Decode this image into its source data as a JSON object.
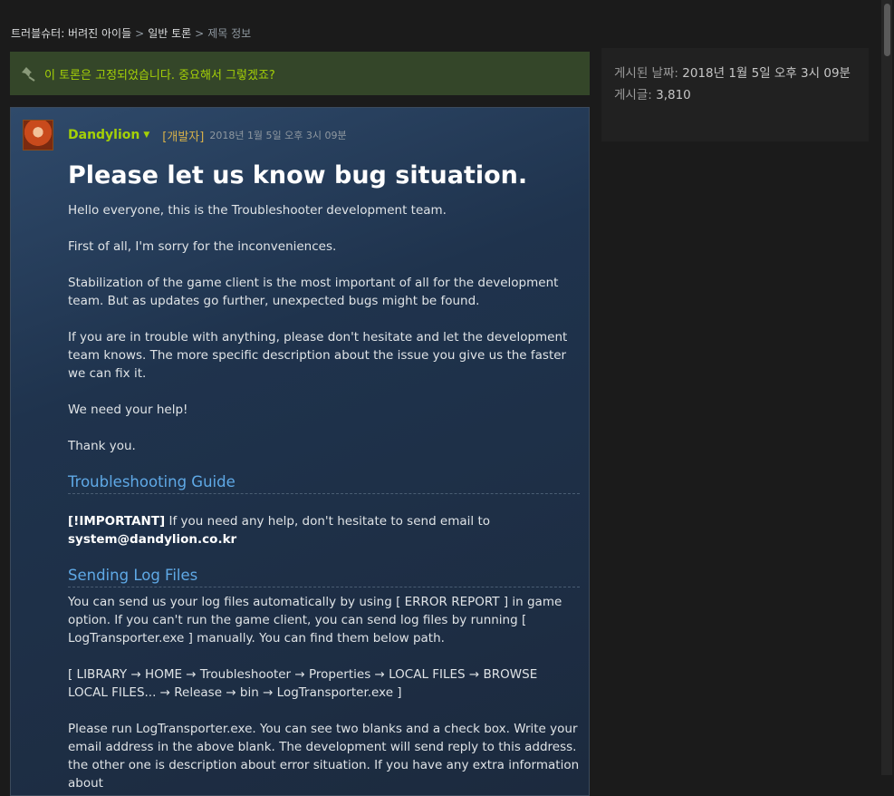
{
  "breadcrumb": {
    "items": [
      "트러블슈터: 버려진 아이들",
      "일반 토론",
      "제목 정보"
    ],
    "separator": ">"
  },
  "pinned_notice": {
    "text": "이 토론은 고정되었습니다. 중요해서 그렇겠죠?",
    "icon": "pin-icon"
  },
  "post": {
    "author": "Dandylion",
    "role": "[개발자]",
    "date": "2018년 1월 5일 오후 3시 09분",
    "title": "Please let us know bug situation.",
    "paragraphs": {
      "p1": "Hello everyone, this is the Troubleshooter development team.",
      "p2": "First of all, I'm sorry for the inconveniences.",
      "p3": "Stabilization of the game client is the most important of all for the development team. But as updates go further, unexpected bugs might be found.",
      "p4": "If you are in trouble with anything, please don't hesitate and let the development team knows. The more specific description about the issue you give us the faster we can fix it.",
      "p5": "We need your help!",
      "p6": "Thank you."
    },
    "section1": {
      "heading": "Troubleshooting Guide",
      "important_label": "[!IMPORTANT]",
      "important_text": " If you need any help, don't hesitate to send email to ",
      "email": "system@dandylion.co.kr"
    },
    "section2": {
      "heading": "Sending Log Files",
      "p1": "You can send us your log files automatically by using [ ERROR REPORT ] in game option. If you can't run the game client, you can send log files by running [ LogTransporter.exe ] manually. You can find them below path.",
      "p2": "[ LIBRARY → HOME → Troubleshooter → Properties → LOCAL FILES → BROWSE LOCAL FILES... → Release → bin → LogTransporter.exe ]",
      "p3": "Please run LogTransporter.exe. You can see two blanks and a check box. Write your email address in the above blank. The development will send reply to this address. the other one is description about error situation. If you have any extra information about"
    }
  },
  "sidebar": {
    "posted_label": "게시된 날짜:",
    "posted_value": "2018년 1월 5일 오후 3시 09분",
    "posts_label": "게시글:",
    "posts_value": "3,810"
  },
  "colors": {
    "page_bg": "#1b1b1b",
    "pinned_bg": "#344629",
    "accent_green": "#a4d007",
    "link_blue": "#5fa9e6",
    "dev_tag": "#d6b04a"
  }
}
